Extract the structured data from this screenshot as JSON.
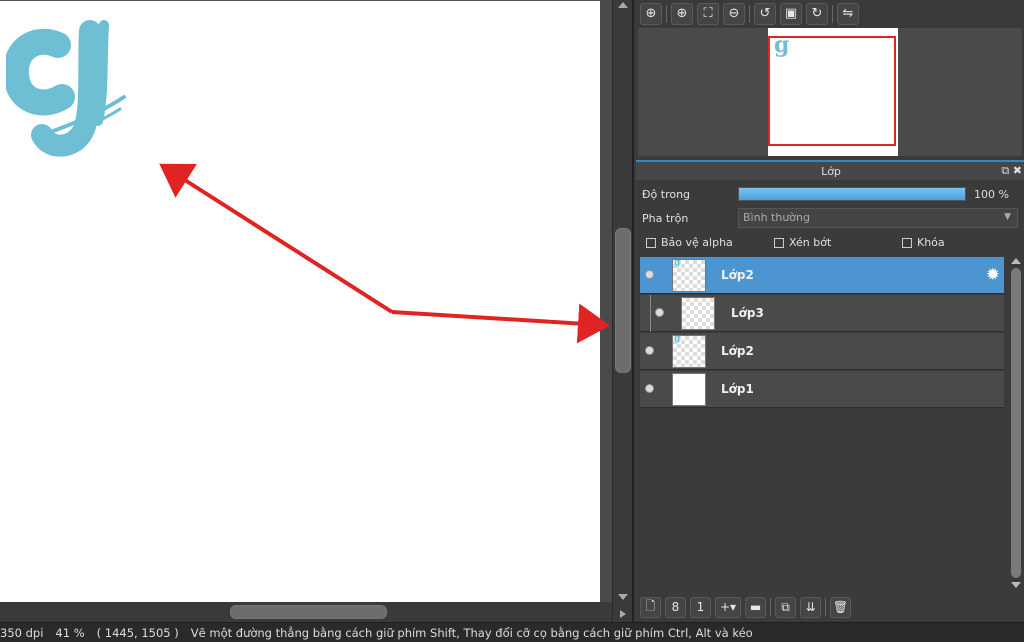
{
  "colors": {
    "accent": "#4d95d0",
    "arrow": "#e02424",
    "letter": "#6fbfd4",
    "panel_bg": "#3b3b3b",
    "canvas_bg": "#ffffff"
  },
  "canvas": {
    "drawing_letter": "g"
  },
  "navigator_toolbar": {
    "icons": [
      "zoom-fit-icon",
      "zoom-in-icon",
      "fit-window-icon",
      "zoom-out-icon",
      "rotate-left-icon",
      "reset-view-icon",
      "rotate-right-icon",
      "flip-horizontal-icon"
    ]
  },
  "layer_panel": {
    "title": "Lớp",
    "opacity_label": "Độ trong",
    "opacity_value": "100 %",
    "opacity_fraction": 1.0,
    "blend_label": "Pha trộn",
    "blend_value": "Bình thường",
    "protect_alpha": "Bảo vệ alpha",
    "clipping": "Xén bớt",
    "lock": "Khóa",
    "layers": [
      {
        "name": "Lớp2",
        "selected": true,
        "thumb": "transparent-g"
      },
      {
        "name": "Lớp3",
        "selected": false,
        "thumb": "transparent",
        "clipped": true
      },
      {
        "name": "Lớp2",
        "selected": false,
        "thumb": "transparent-g"
      },
      {
        "name": "Lớp1",
        "selected": false,
        "thumb": "white"
      }
    ]
  },
  "layer_toolbar": {
    "icons": [
      "new-layer-icon",
      "new-8bit-layer-icon",
      "new-1bit-layer-icon",
      "add-layer-menu-icon",
      "folder-icon",
      "duplicate-layer-icon",
      "merge-layer-icon",
      "delete-layer-icon"
    ]
  },
  "statusbar": {
    "dpi": "350 dpi",
    "zoom": "41 %",
    "cursor": "( 1445, 1505 )",
    "hint": "Vẽ một đường thẳng bằng cách giữ phím Shift, Thay đổi cỡ cọ bằng cách giữ phím Ctrl, Alt và kéo"
  }
}
